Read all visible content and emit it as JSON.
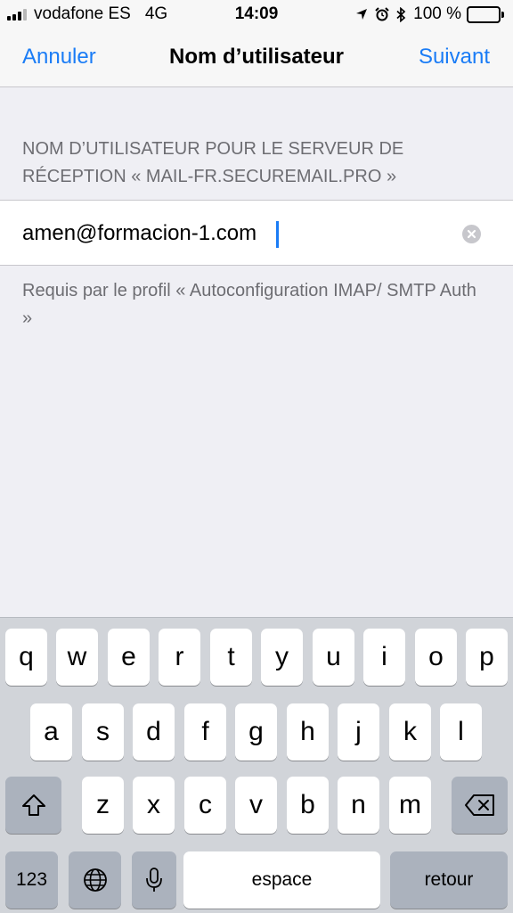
{
  "status_bar": {
    "carrier": "vodafone ES",
    "network": "4G",
    "time": "14:09",
    "battery_text": "100 %",
    "battery_level": 1.0,
    "signal_bars": 3,
    "icons": [
      "location-arrow-icon",
      "alarm-icon",
      "bluetooth-icon",
      "battery-icon"
    ],
    "battery_color": "#4cd964"
  },
  "nav": {
    "cancel_label": "Annuler",
    "title": "Nom d’utilisateur",
    "next_label": "Suivant",
    "accent_color": "#1a7cf6"
  },
  "form": {
    "section_header": "NOM D’UTILISATEUR POUR LE SERVEUR DE RÉCEPTION « MAIL-FR.SECUREMAIL.PRO »",
    "username_value": "amen@formacion-1.com",
    "footer": "Requis par le profil « Autoconfiguration IMAP/ SMTP Auth »"
  },
  "keyboard": {
    "row1": [
      "q",
      "w",
      "e",
      "r",
      "t",
      "y",
      "u",
      "i",
      "o",
      "p"
    ],
    "row2": [
      "a",
      "s",
      "d",
      "f",
      "g",
      "h",
      "j",
      "k",
      "l"
    ],
    "row3": [
      "z",
      "x",
      "c",
      "v",
      "b",
      "n",
      "m"
    ],
    "numbers_label": "123",
    "space_label": "espace",
    "return_label": "retour",
    "icons": [
      "shift-icon",
      "backspace-icon",
      "globe-icon",
      "microphone-icon"
    ]
  }
}
